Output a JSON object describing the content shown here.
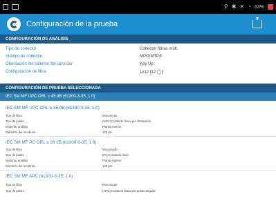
{
  "status_bar": {
    "battery_percent": "63%",
    "battery_color": "#e8473a",
    "right_icons": [
      "location-icon",
      "bluetooth-icon",
      "mute-icon",
      "wifi-icon"
    ]
  },
  "app_bar": {
    "title": "Configuración de la prueba",
    "background": "#1d8ecf"
  },
  "analysis_section": {
    "header": "CONFIGURACIÓN DE ANÁLISIS",
    "rows": [
      {
        "label": "Tipo de conector",
        "value": "Conector fibras múlt."
      },
      {
        "label": "Subtipo de conector",
        "value": "MPO/MTP®"
      },
      {
        "label": "Orientación del saliente del conector",
        "value": "Key Up"
      },
      {
        "label": "Configuración de fibra",
        "value": "1x12 [12 ◯]"
      }
    ]
  },
  "selected_section": {
    "header": "CONFIGURACIÓN DE PRUEBA SELECCIONADA",
    "subheader": "IEC SM MF UPC ORL ≥ 45 dB (61300-3-35, 1.0)",
    "tests": [
      {
        "title": "IEC SM MF UPC ORL ≥ 45 dB (61300-3-35, 1.0)",
        "rows": [
          {
            "label": "Tipo de fibra",
            "value": "Monomodo"
          },
          {
            "label": "Tipo de pulido",
            "value": "(UPC) Contacto físico por ultrapulido"
          },
          {
            "label": "Modo de análisis",
            "value": "Planta exterior"
          },
          {
            "label": "Diámetro del recubrimi...",
            "value": "125 µm"
          }
        ]
      },
      {
        "title": "IEC SM MF PC ORL ≥ 26 dB (61300-3-35, 1.0)",
        "rows": [
          {
            "label": "Tipo de fibra",
            "value": "Monomodo"
          },
          {
            "label": "Tipo de pulido",
            "value": "(PC) Contacto físico"
          },
          {
            "label": "Modo de análisis",
            "value": "Planta exterior"
          },
          {
            "label": "Diámetro del recubrimi...",
            "value": "125 µm"
          }
        ]
      },
      {
        "title": "IEC SM MF APC (61300-3-35, 1.0)",
        "rows": [
          {
            "label": "Tipo de fibra",
            "value": "Monomodo"
          },
          {
            "label": "Tipo de pulido",
            "value": "(APC) Contacto físico por pulido angular"
          }
        ]
      }
    ]
  }
}
